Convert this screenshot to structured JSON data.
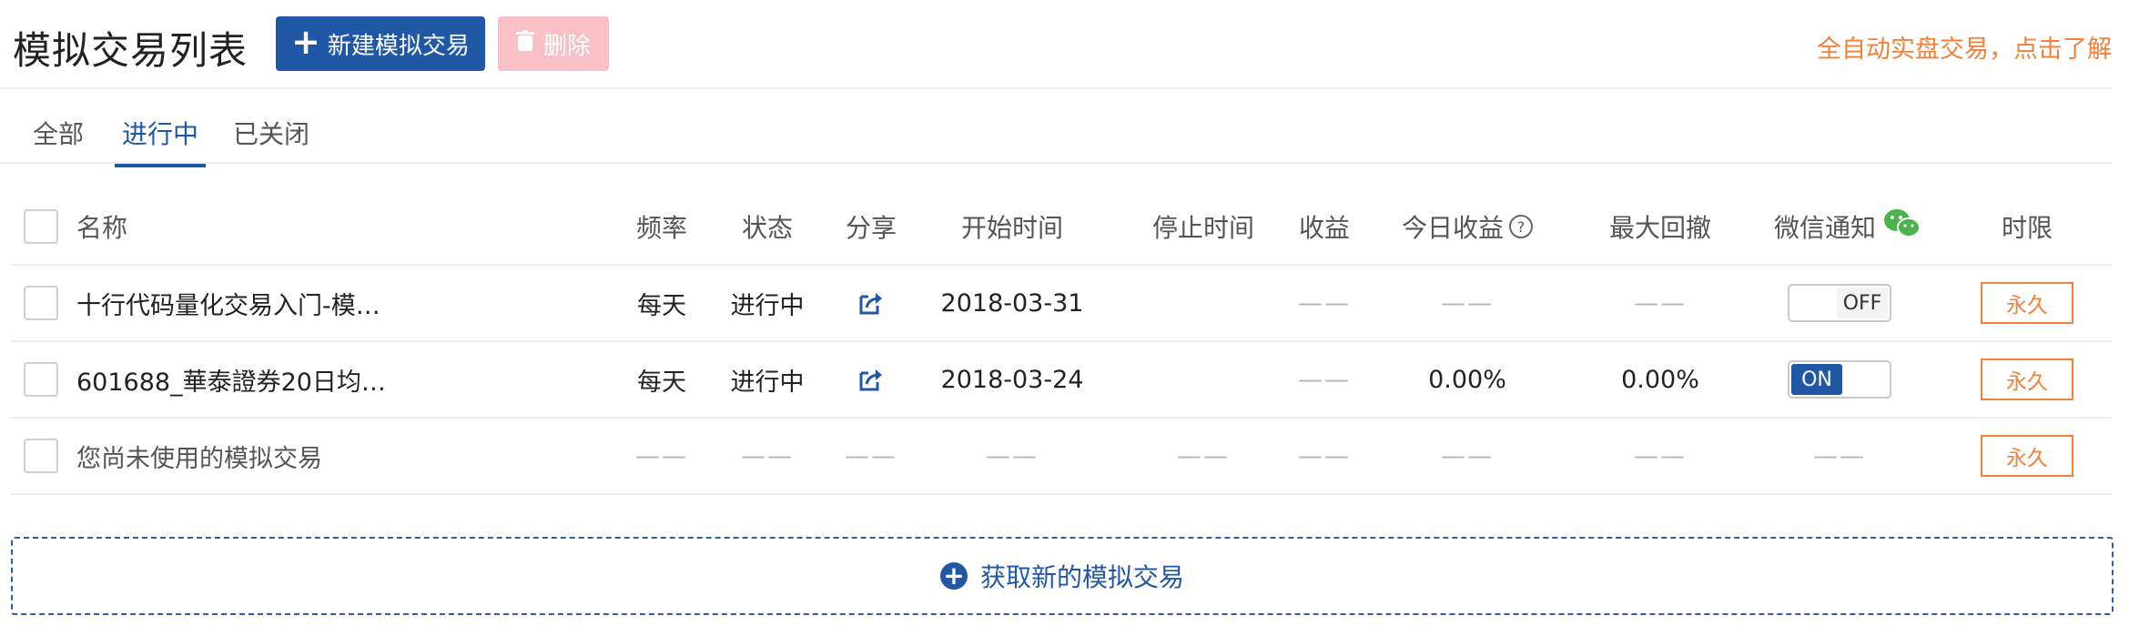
{
  "header": {
    "title": "模拟交易列表",
    "new_button": "新建模拟交易",
    "delete_button": "删除",
    "promo_link": "全自动实盘交易，点击了解"
  },
  "tabs": [
    "全部",
    "进行中",
    "已关闭"
  ],
  "active_tab": "进行中",
  "table": {
    "columns": [
      "名称",
      "频率",
      "状态",
      "分享",
      "开始时间",
      "停止时间",
      "收益",
      "今日收益",
      "最大回撤",
      "微信通知",
      "时限"
    ],
    "rows": [
      {
        "name": "十行代码量化交易入门-模…",
        "freq": "每天",
        "status": "进行中",
        "start": "2018-03-31",
        "stop": "",
        "profit": "——",
        "today": "——",
        "drawdown": "——",
        "wechat": "OFF",
        "limit": "永久"
      },
      {
        "name": "601688_華泰證券20日均…",
        "freq": "每天",
        "status": "进行中",
        "start": "2018-03-24",
        "stop": "",
        "profit": "——",
        "today": "0.00%",
        "drawdown": "0.00%",
        "wechat": "ON",
        "limit": "永久"
      },
      {
        "name": "您尚未使用的模拟交易",
        "freq": "——",
        "status": "——",
        "share": "——",
        "start": "——",
        "stop": "——",
        "profit": "——",
        "today": "——",
        "drawdown": "——",
        "wechat": "——",
        "limit": "永久"
      }
    ]
  },
  "footer": {
    "add_label": "获取新的模拟交易"
  },
  "colors": {
    "primary": "#2058a6",
    "accent": "#f3813a",
    "disabled": "#f9c1c6",
    "wechat": "#4bb24d"
  }
}
